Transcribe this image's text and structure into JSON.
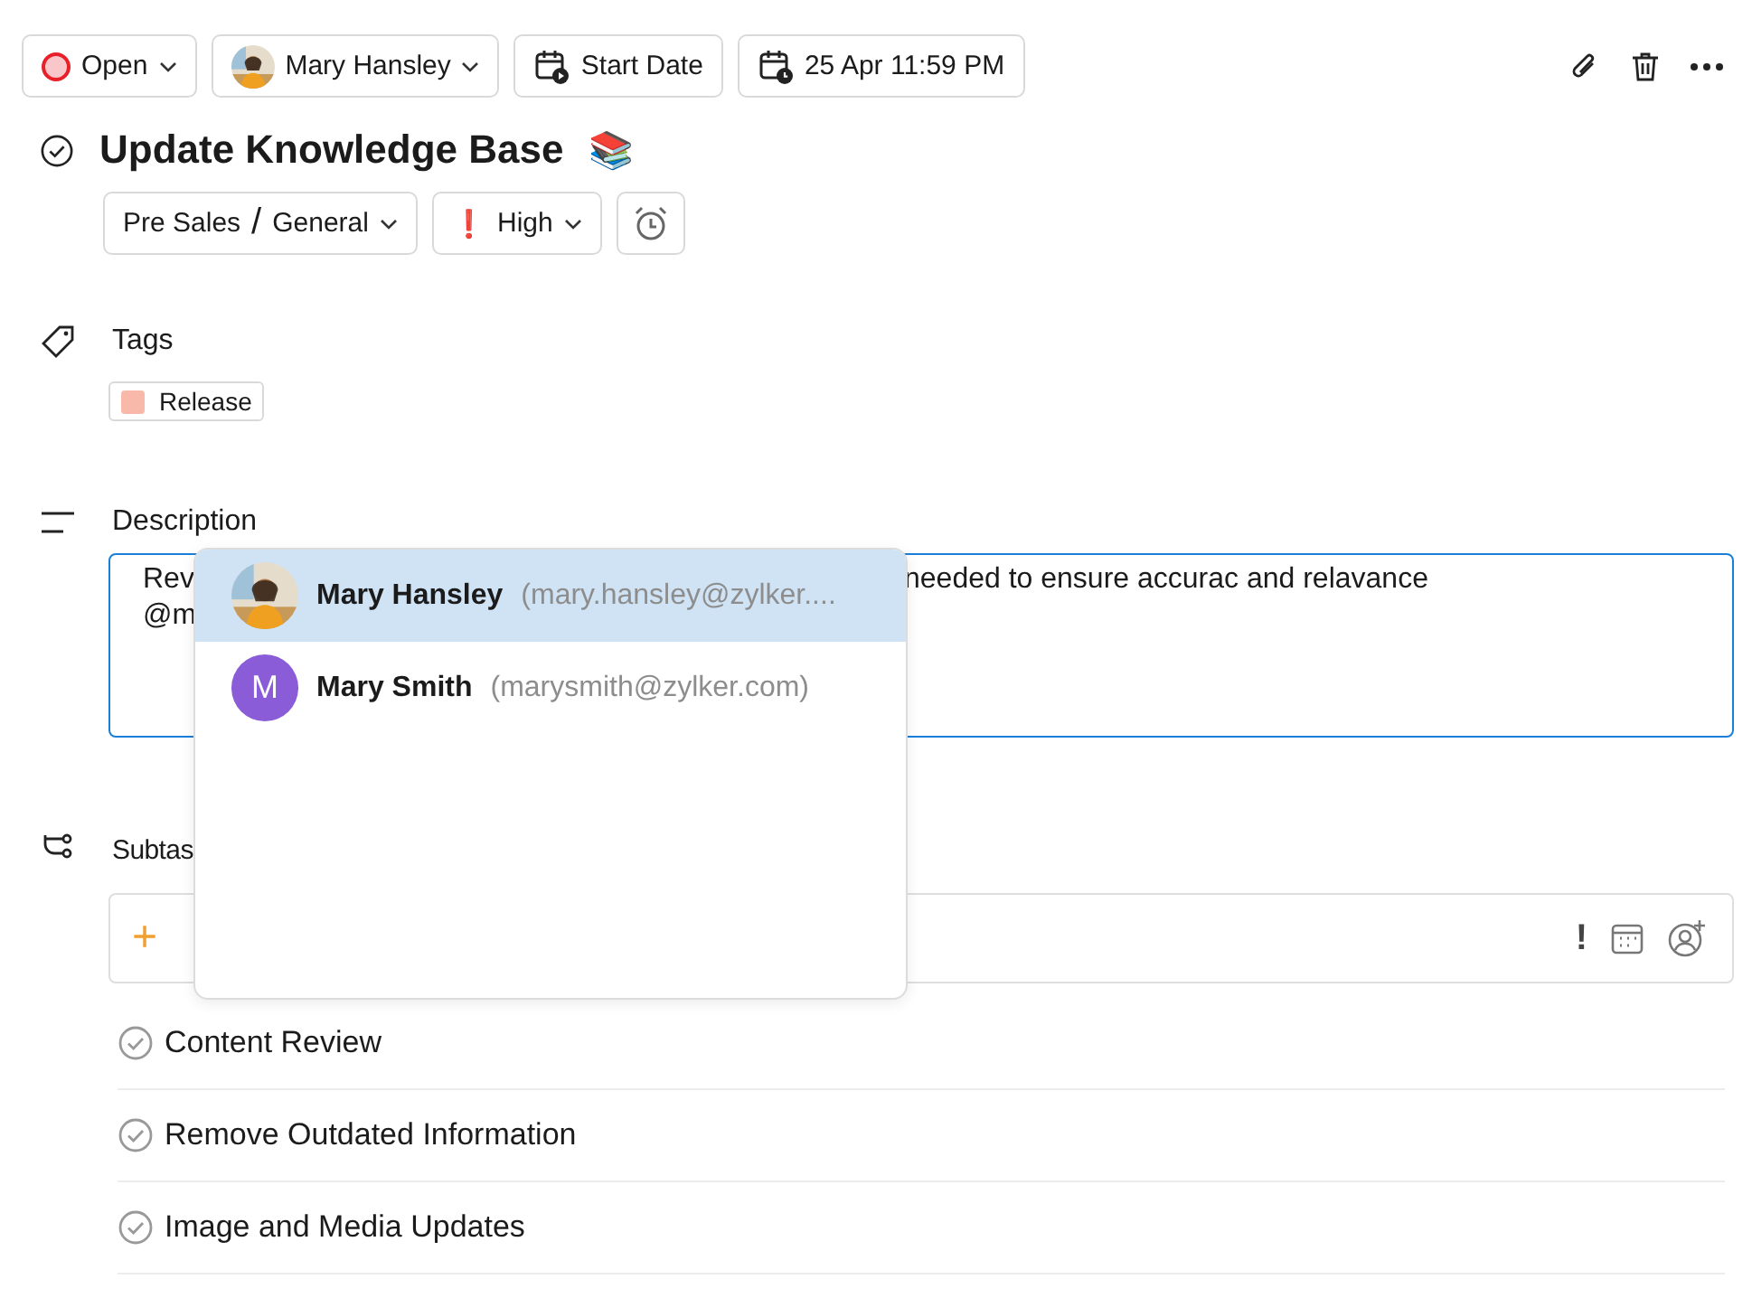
{
  "toolbar": {
    "status": {
      "label": "Open",
      "color": "#e8202a"
    },
    "assignee": {
      "name": "Mary Hansley"
    },
    "start_date": "Start Date",
    "due_date": "25 Apr 11:59 PM"
  },
  "task": {
    "title": "Update Knowledge Base",
    "emoji": "📚",
    "completed": false,
    "project": "Pre Sales",
    "separator": "/",
    "section": "General",
    "priority": {
      "mark": "❗",
      "label": "High"
    }
  },
  "tags": {
    "label": "Tags",
    "items": [
      {
        "label": "Release",
        "color": "#f8b9aa"
      }
    ]
  },
  "description": {
    "label": "Description",
    "lines": [
      [
        "Rev",
        "needed to ensure accurac and relavance"
      ],
      [
        "@m"
      ]
    ]
  },
  "mention_popup": {
    "items": [
      {
        "name": "Mary Hansley",
        "email": "(mary.hansley@zylker....",
        "selected": true
      },
      {
        "name": "Mary Smith",
        "email": "(marysmith@zylker.com)",
        "avatar": {
          "kind": "initial",
          "initial": "M",
          "color": "#8a5cd8"
        },
        "selected": false
      }
    ]
  },
  "subtasks": {
    "label": "Subtas",
    "add_mark": "+",
    "priority_mark": "!",
    "items": [
      {
        "title": "Content Review",
        "completed": false
      },
      {
        "title": "Remove Outdated Information",
        "completed": false
      },
      {
        "title": "Image and Media Updates",
        "completed": false
      }
    ]
  }
}
